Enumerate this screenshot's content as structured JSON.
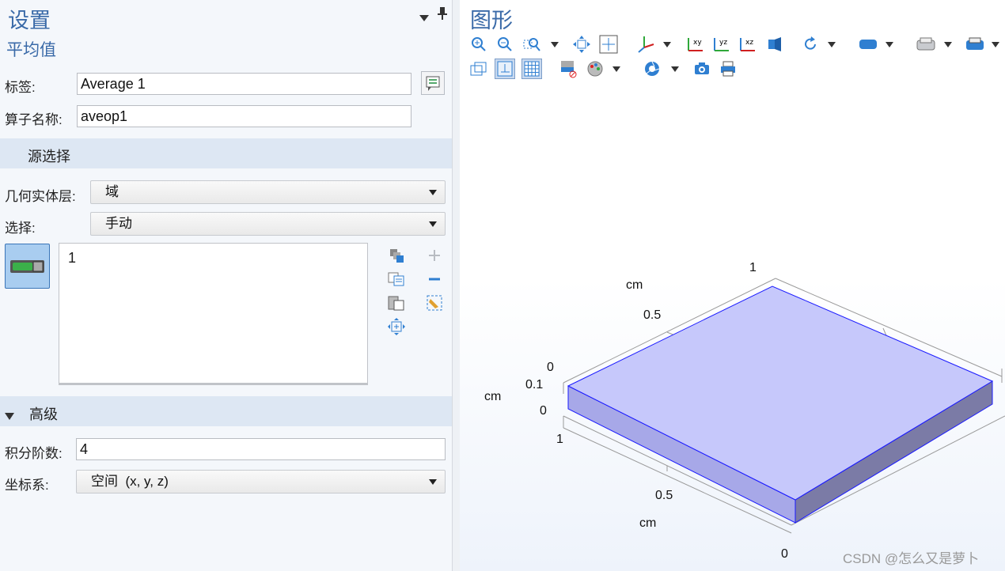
{
  "settings": {
    "title": "设置",
    "subtitle": "平均值",
    "label_field": {
      "label": "标签:",
      "value": "Average 1"
    },
    "operator_field": {
      "label": "算子名称:",
      "value": "aveop1"
    },
    "source_section": {
      "title": "源选择"
    },
    "geometric_level": {
      "label": "几何实体层:",
      "value": "域"
    },
    "selection": {
      "label": "选择:",
      "value": "手动"
    },
    "selection_list": [
      "1"
    ],
    "advanced_section": {
      "title": "高级"
    },
    "integration_order": {
      "label": "积分阶数:",
      "value": "4"
    },
    "coord_system": {
      "label": "坐标系:",
      "value": "空间  (x, y, z)"
    }
  },
  "graphics": {
    "title": "图形",
    "toolbar_row1": [
      "zoom-in-icon",
      "zoom-out-icon",
      "zoom-box-icon",
      "zoom-extents-icon",
      "scene-light-icon",
      "view-xy-icon",
      "view-yz-icon",
      "view-xz-icon",
      "render-icon",
      "rotate-icon",
      "transparency-icon",
      "select-icon",
      "print-options-icon"
    ],
    "axis_labels": {
      "top_value_1": "1",
      "top_unit": "cm",
      "top_value_05": "0.5",
      "top_value_0": "0",
      "z_value_01": "0.1",
      "z_unit": "cm",
      "z_value_0": "0",
      "left_value_1": "1",
      "bottom_value_05": "0.5",
      "bottom_unit": "cm",
      "bottom_value_0": "0"
    },
    "watermark": "CSDN @怎么又是萝卜"
  },
  "colors": {
    "accent": "#3a6aa8",
    "section_bg": "#dde7f3",
    "block_top": "#c6c8fb",
    "block_side": "#7b7ba6",
    "block_edge": "#1a1aff"
  }
}
